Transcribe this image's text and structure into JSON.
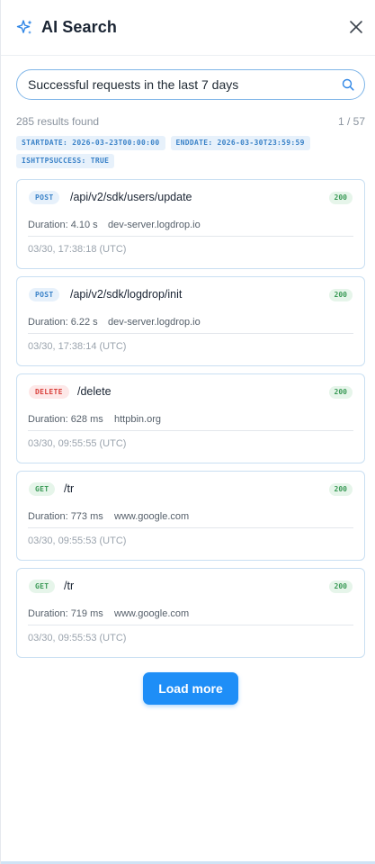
{
  "header": {
    "title": "AI Search",
    "logo_icon": "sparkles-icon",
    "close_icon": "close-icon"
  },
  "search": {
    "value": "Successful requests in the last 7 days",
    "icon": "search-icon",
    "accent": "#7fb5e8"
  },
  "results": {
    "count_text": "285 results found",
    "page_text": "1 / 57"
  },
  "filters": [
    "STARTDATE: 2026-03-23T00:00:00",
    "ENDDATE: 2026-03-30T23:59:59",
    "ISHTTPSUCCESS: TRUE"
  ],
  "requests": [
    {
      "method": "POST",
      "path": "/api/v2/sdk/users/update",
      "status": "200",
      "duration": "Duration: 4.10 s",
      "host": "dev-server.logdrop.io",
      "time": "03/30, 17:38:18 (UTC)"
    },
    {
      "method": "POST",
      "path": "/api/v2/sdk/logdrop/init",
      "status": "200",
      "duration": "Duration: 6.22 s",
      "host": "dev-server.logdrop.io",
      "time": "03/30, 17:38:14 (UTC)"
    },
    {
      "method": "DELETE",
      "path": "/delete",
      "status": "200",
      "duration": "Duration: 628 ms",
      "host": "httpbin.org",
      "time": "03/30, 09:55:55 (UTC)"
    },
    {
      "method": "GET",
      "path": "/tr",
      "status": "200",
      "duration": "Duration: 773 ms",
      "host": "www.google.com",
      "time": "03/30, 09:55:53 (UTC)"
    },
    {
      "method": "GET",
      "path": "/tr",
      "status": "200",
      "duration": "Duration: 719 ms",
      "host": "www.google.com",
      "time": "03/30, 09:55:53 (UTC)"
    }
  ],
  "load_more_label": "Load more",
  "colors": {
    "primary": "#1e8ef7",
    "post": "#3a82c8",
    "delete": "#d9413c",
    "get": "#3a9a56",
    "success": "#3a9a56"
  }
}
